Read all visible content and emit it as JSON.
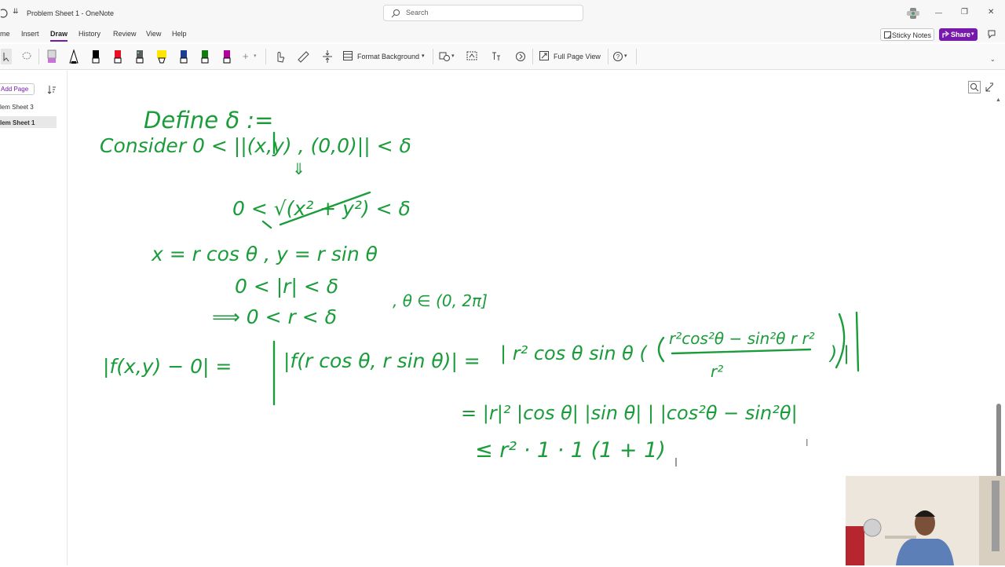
{
  "window": {
    "title": "Problem Sheet 1  -  OneNote",
    "controls": {
      "minimize": "—",
      "restore": "❐",
      "close": "✕"
    }
  },
  "search": {
    "placeholder": "Search"
  },
  "menu": {
    "items": [
      "me",
      "Insert",
      "Draw",
      "History",
      "Review",
      "View",
      "Help"
    ],
    "active": "Draw"
  },
  "header_buttons": {
    "sticky_notes": "Sticky Notes",
    "share": "Share"
  },
  "ribbon": {
    "format_background": "Format Background",
    "full_page_view": "Full Page View",
    "pen_colors": [
      "#c873d6",
      "#000000",
      "#000000",
      "#e81123",
      "#5c5c5c",
      "#ffe600",
      "#1c3f94",
      "#107c10",
      "#b4009e"
    ]
  },
  "sidebar": {
    "add_page": "Add Page",
    "pages": [
      {
        "label": "lem Sheet 3",
        "selected": false
      },
      {
        "label": "lem Sheet 1",
        "selected": true
      }
    ]
  },
  "ink": {
    "color": "#1a9c3a",
    "lines": [
      "Define δ :=",
      "Consider  0 < ||(x,y) , (0,0)|| < δ",
      "⇓",
      "0 < √(x² + y²) < δ",
      "x = r cos θ ,  y = r sin θ",
      "0 < |r| < δ",
      "⟹  0 < r < δ",
      ",  θ ∈ (0, 2π]",
      "|f(x,y) − 0| =",
      "|f(r cos θ, r sin θ)| =",
      "| r² cos θ sin θ (",
      "r²cos²θ − sin²θ r r²",
      "r²",
      ") |",
      "= |r|² |cos θ| |sin θ| | |cos²θ − sin²θ|",
      "≤  r² · 1 · 1 (1 + 1)"
    ]
  },
  "accent_color": "#7719aa"
}
